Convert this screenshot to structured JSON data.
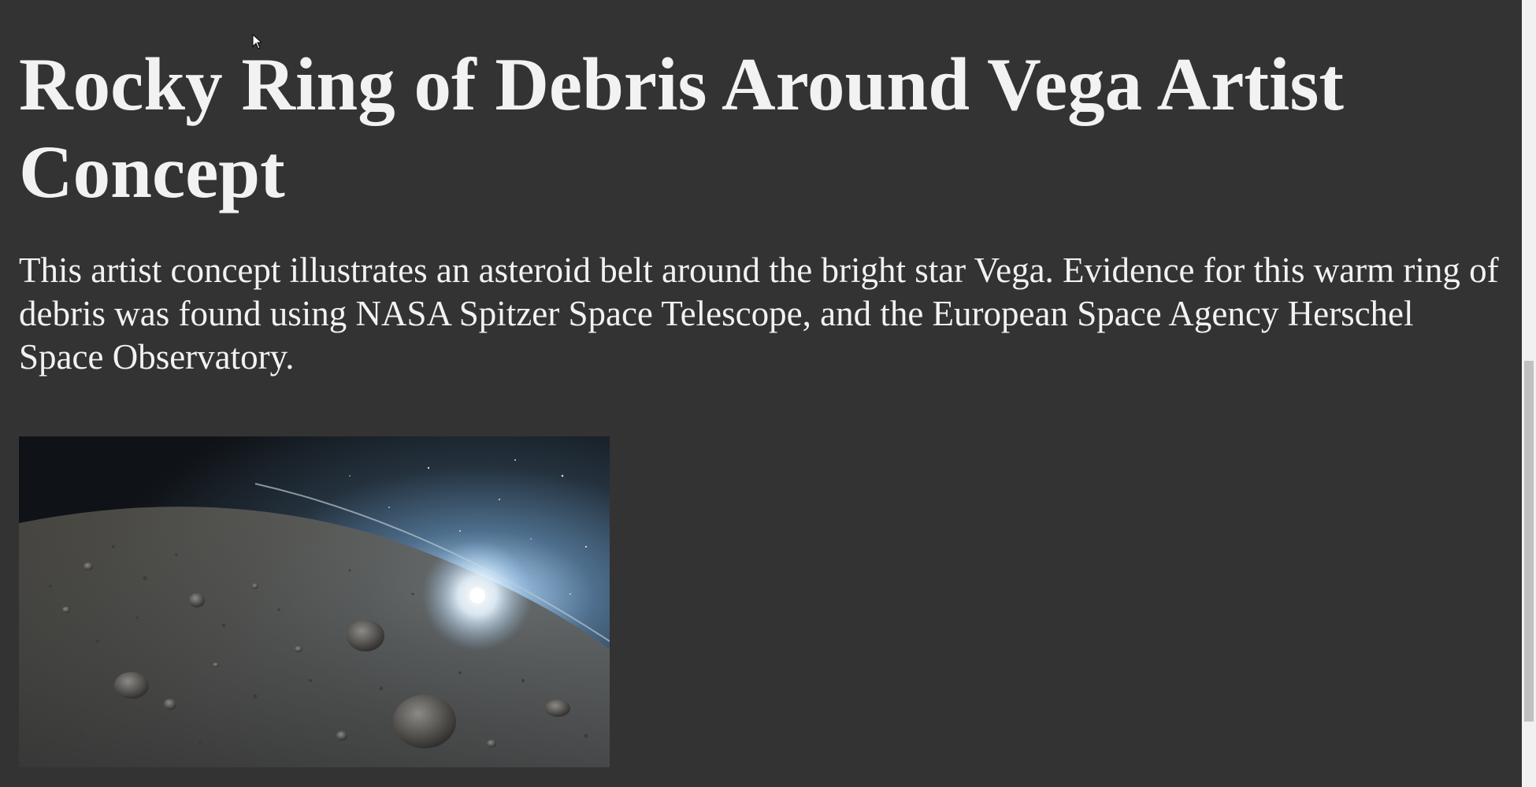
{
  "page": {
    "title": "Rocky Ring of Debris Around Vega Artist Concept",
    "description": "This artist concept illustrates an asteroid belt around the bright star Vega. Evidence for this warm ring of debris was found using NASA Spitzer Space Telescope, and the European Space Agency Herschel Space Observatory."
  },
  "image": {
    "alt": "Rocky Ring of Debris Around Vega Artist Concept"
  },
  "colors": {
    "background": "#333333",
    "text": "#f2f2f2",
    "scrollbar_track": "#f1f1f1",
    "scrollbar_thumb": "#c1c1c1"
  },
  "icons": {
    "cursor": "arrow-cursor-icon"
  }
}
